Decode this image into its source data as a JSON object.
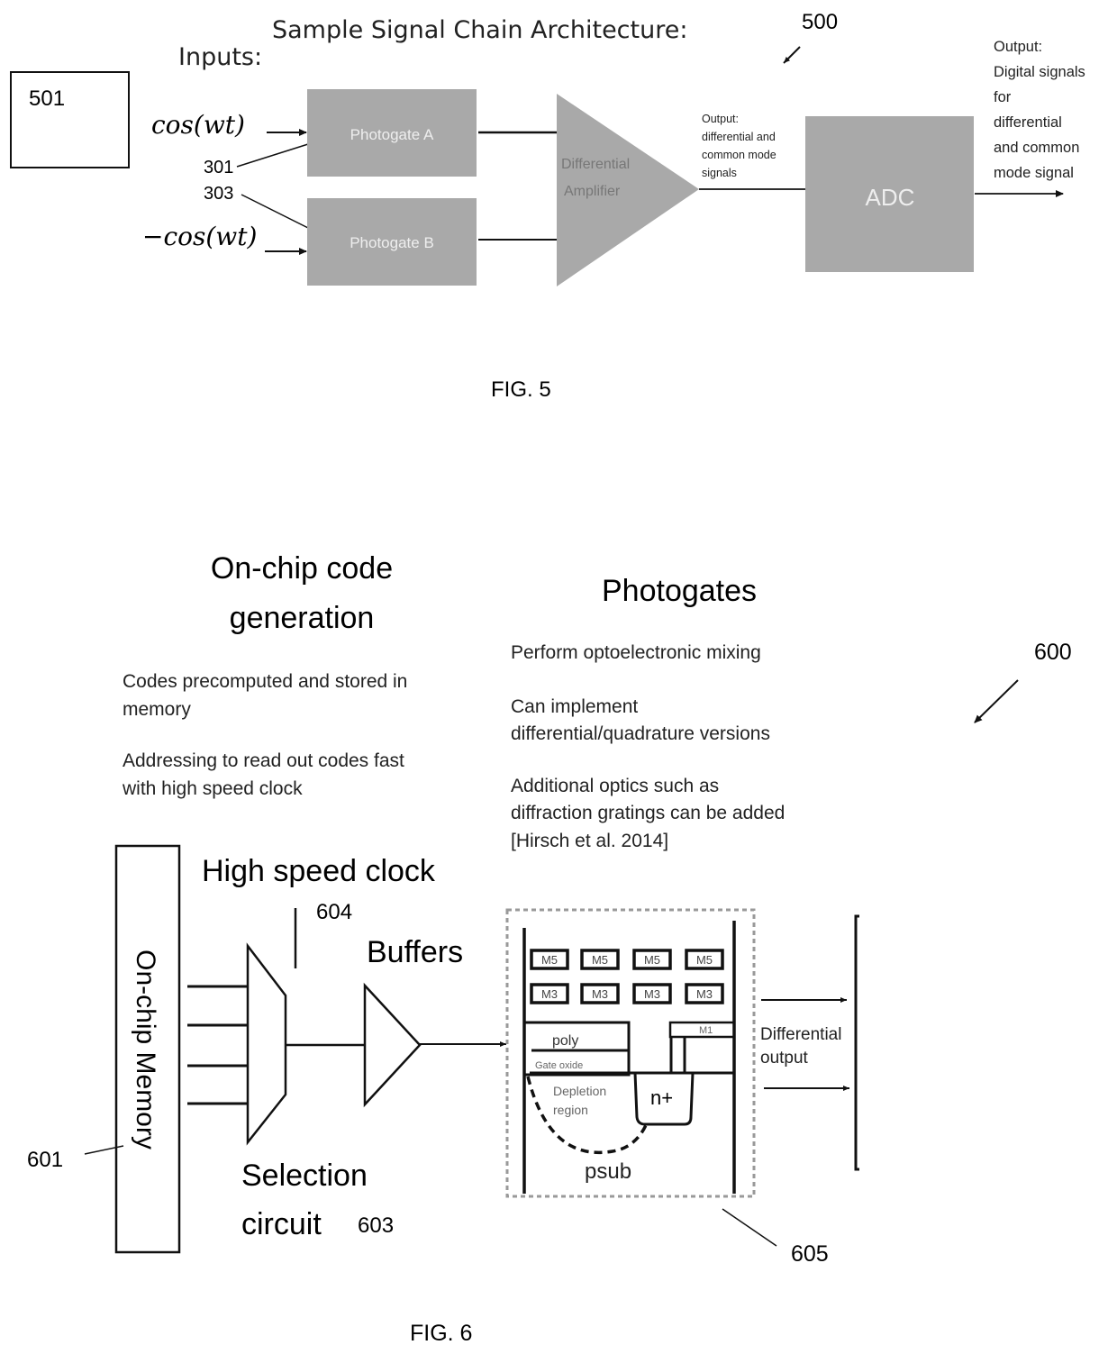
{
  "fig5": {
    "ref": "500",
    "title": "Sample Signal Chain Architecture:",
    "inputs_label": "Inputs:",
    "box_501": "501",
    "input_a": "cos(wt)",
    "input_b": "−cos(wt)",
    "ref_301": "301",
    "ref_303": "303",
    "photogate_a": "Photogate A",
    "photogate_b": "Photogate B",
    "amp_line1": "Differential",
    "amp_line2": "Amplifier",
    "amp_output": [
      "Output:",
      "differential and",
      "common mode",
      "signals"
    ],
    "adc": "ADC",
    "final_output": [
      "Output:",
      "Digital signals",
      "for",
      "differential",
      "and common",
      "mode signal"
    ],
    "caption": "FIG. 5"
  },
  "fig6": {
    "ref": "600",
    "code_gen_title": [
      "On-chip code",
      "generation"
    ],
    "code_gen_points": [
      [
        "Codes precomputed and stored in",
        "memory"
      ],
      [
        "Addressing to read out codes fast",
        "with high speed clock"
      ]
    ],
    "photogates_title": "Photogates",
    "photogates_points": [
      [
        "Perform optoelectronic mixing"
      ],
      [
        "Can implement",
        "differential/quadrature versions"
      ],
      [
        "Additional optics such as",
        "diffraction gratings can be added",
        "[Hirsch et al. 2014]"
      ]
    ],
    "memory_label": "On-chip Memory",
    "ref_601": "601",
    "clock_label": "High speed clock",
    "ref_604": "604",
    "buffers_label": "Buffers",
    "selection_label": [
      "Selection",
      "circuit"
    ],
    "ref_603": "603",
    "metal_top": [
      "M5",
      "M5",
      "M5",
      "M5"
    ],
    "metal_mid": [
      "M3",
      "M3",
      "M3",
      "M3"
    ],
    "m1_label": "M1",
    "poly_label": "poly",
    "gate_oxide_label": "Gate oxide",
    "depletion_label": [
      "Depletion",
      "region"
    ],
    "nplus_label": "n+",
    "psub_label": "psub",
    "diff_output": [
      "Differential",
      "output"
    ],
    "ref_605": "605",
    "caption": "FIG.  6"
  }
}
